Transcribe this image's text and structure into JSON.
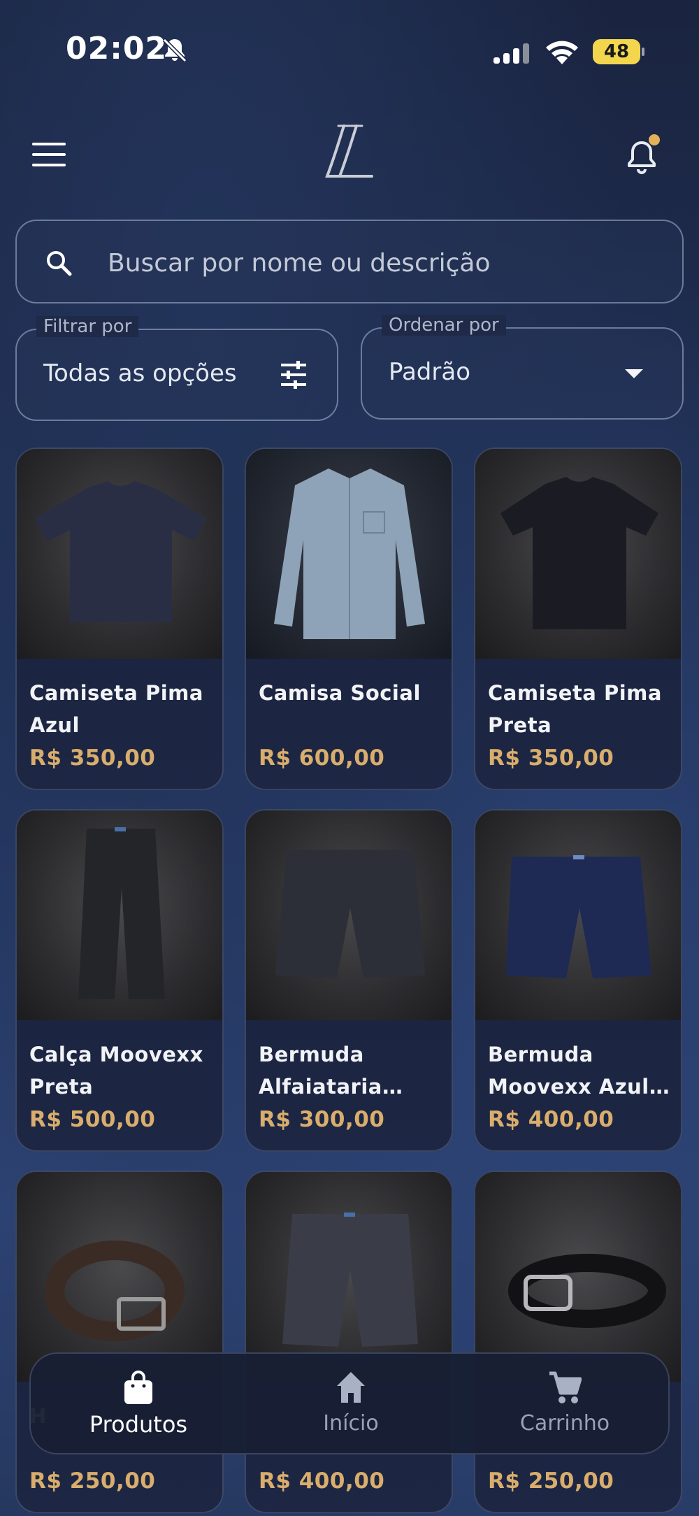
{
  "status_bar": {
    "time": "02:02",
    "battery": "48"
  },
  "header": {
    "logo": "LL",
    "menu_icon": "menu-icon",
    "notification_icon": "bell-icon"
  },
  "search": {
    "placeholder": "Buscar por nome ou descrição"
  },
  "filter": {
    "label": "Filtrar por",
    "value": "Todas as opções"
  },
  "sort": {
    "label": "Ordenar por",
    "value": "Padrão"
  },
  "products": [
    {
      "name": "Camiseta Pima Azul",
      "price": "R$ 350,00"
    },
    {
      "name": "Camisa Social",
      "price": "R$ 600,00"
    },
    {
      "name": "Camiseta Pima Preta",
      "price": "R$ 350,00"
    },
    {
      "name": "Calça Moovexx Preta",
      "price": "R$ 500,00"
    },
    {
      "name": "Bermuda Alfaiataria Chu…",
      "price": "R$ 300,00"
    },
    {
      "name": "Bermuda Moovexx Azul …",
      "price": "R$ 400,00"
    },
    {
      "name": "H",
      "price": "R$ 250,00"
    },
    {
      "name": "",
      "price": "R$ 400,00"
    },
    {
      "name": "",
      "price": "R$ 250,00"
    }
  ],
  "bottom_nav": [
    {
      "label": "Produtos",
      "icon": "shopping-bag-icon",
      "active": true
    },
    {
      "label": "Início",
      "icon": "home-icon",
      "active": false
    },
    {
      "label": "Carrinho",
      "icon": "cart-icon",
      "active": false
    }
  ],
  "colors": {
    "accent_gold": "#d9ad6c",
    "notification_dot": "#e2b25a",
    "battery": "#f3d64e"
  }
}
